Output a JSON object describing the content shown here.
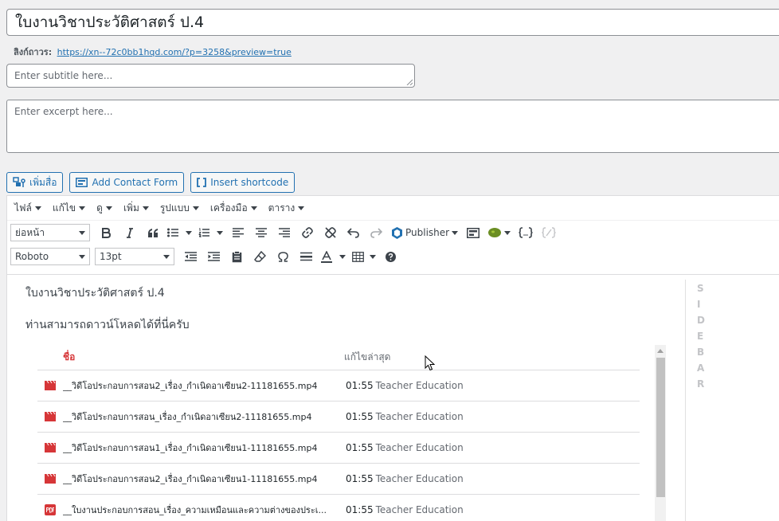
{
  "post": {
    "title": "ใบงานวิชาประวัติศาสตร์ ป.4",
    "permalink_label": "ลิงก์ถาวร:",
    "permalink_url": "https://xn--72c0bb1hqd.com/?p=3258&preview=true",
    "subtitle_placeholder": "Enter subtitle here...",
    "excerpt_placeholder": "Enter excerpt here..."
  },
  "media_buttons": {
    "add_media": "เพิ่มสื่อ",
    "contact_form": "Add Contact Form",
    "shortcode": "Insert shortcode"
  },
  "menubar": [
    "ไฟล์",
    "แก้ไข",
    "ดู",
    "เพิ่ม",
    "รูปแบบ",
    "เครื่องมือ",
    "ตาราง"
  ],
  "toolbar1": {
    "format_select": "ย่อหน้า",
    "publisher_label": "Publisher"
  },
  "toolbar2": {
    "font_select": "Roboto",
    "size_select": "13pt"
  },
  "content": {
    "title": "ใบงานวิชาประวัติศาสตร์ ป.4",
    "line": "ท่านสามารถดาวน์โหลดได้ที่นี่ครับ",
    "sidebar_letters": [
      "S",
      "I",
      "D",
      "E",
      "B",
      "A",
      "R"
    ]
  },
  "files": {
    "col_name": "ชื่อ",
    "col_modified": "แก้ไขล่าสุด",
    "rows": [
      {
        "type": "video",
        "name": "__วิดีโอประกอบการสอน2_เรื่อง_กำเนิดอาเซียน2-11181655.mp4",
        "time": "01:55",
        "owner": "Teacher Education"
      },
      {
        "type": "video",
        "name": "__วิดีโอประกอบการสอน_เรื่อง_กำเนิดอาเซียน2-11181655.mp4",
        "time": "01:55",
        "owner": "Teacher Education"
      },
      {
        "type": "video",
        "name": "__วิดีโอประกอบการสอน1_เรื่อง_กำเนิดอาเซียน1-11181655.mp4",
        "time": "01:55",
        "owner": "Teacher Education"
      },
      {
        "type": "video",
        "name": "__วิดีโอประกอบการสอน2_เรื่อง_กำเนิดอาเซียน1-11181655.mp4",
        "time": "01:55",
        "owner": "Teacher Education"
      },
      {
        "type": "pdf",
        "name": "__ใบงานประกอบการสอน_เรื่อง_ความเหมือนและความต่างของประเ...",
        "time": "01:55",
        "owner": "Teacher Education"
      }
    ]
  },
  "colors": {
    "accent": "#2271b1",
    "file_red": "#d63638"
  }
}
